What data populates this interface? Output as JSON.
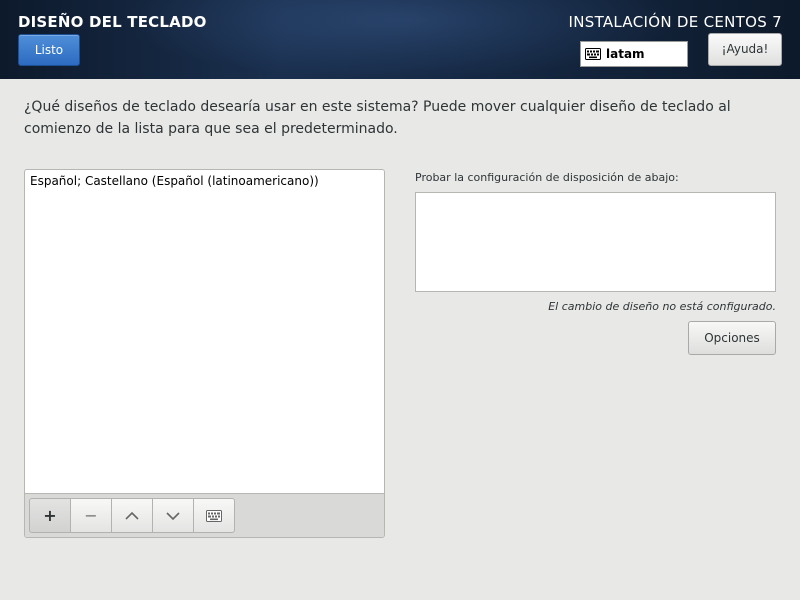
{
  "header": {
    "page_title": "DISEÑO DEL TECLADO",
    "done_label": "Listo",
    "install_title": "INSTALACIÓN DE CENTOS 7",
    "keyboard_indicator": "latam",
    "help_label": "¡Ayuda!"
  },
  "main": {
    "question": "¿Qué diseños de teclado desearía usar en este sistema?  Puede mover cualquier diseño de teclado al comienzo de la lista para que sea el predeterminado.",
    "layouts": [
      "Español; Castellano (Español (latinoamericano))"
    ],
    "toolbar": {
      "add": "+",
      "remove": "−",
      "up": "chevron-up-icon",
      "down": "chevron-down-icon",
      "preview": "keyboard-icon"
    },
    "test_label": "Probar la configuración de disposición de abajo:",
    "test_value": "",
    "layout_switch_note": "El cambio de diseño no está configurado.",
    "options_label": "Opciones"
  }
}
